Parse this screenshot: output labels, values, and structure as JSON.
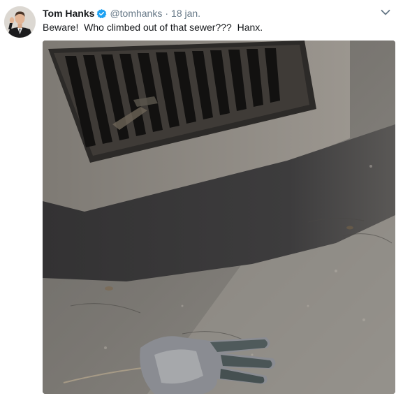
{
  "tweet": {
    "author_name": "Tom Hanks",
    "handle": "@tomhanks",
    "separator": "·",
    "date": "18 jan.",
    "text": "Beware!  Who climbed out of that sewer???  Hanx.",
    "verified": true
  },
  "icons": {
    "verified": "verified-badge-icon",
    "menu": "chevron-down-icon"
  },
  "colors": {
    "name": "#14171a",
    "secondary": "#657786",
    "verified_blue": "#1da1f2"
  }
}
